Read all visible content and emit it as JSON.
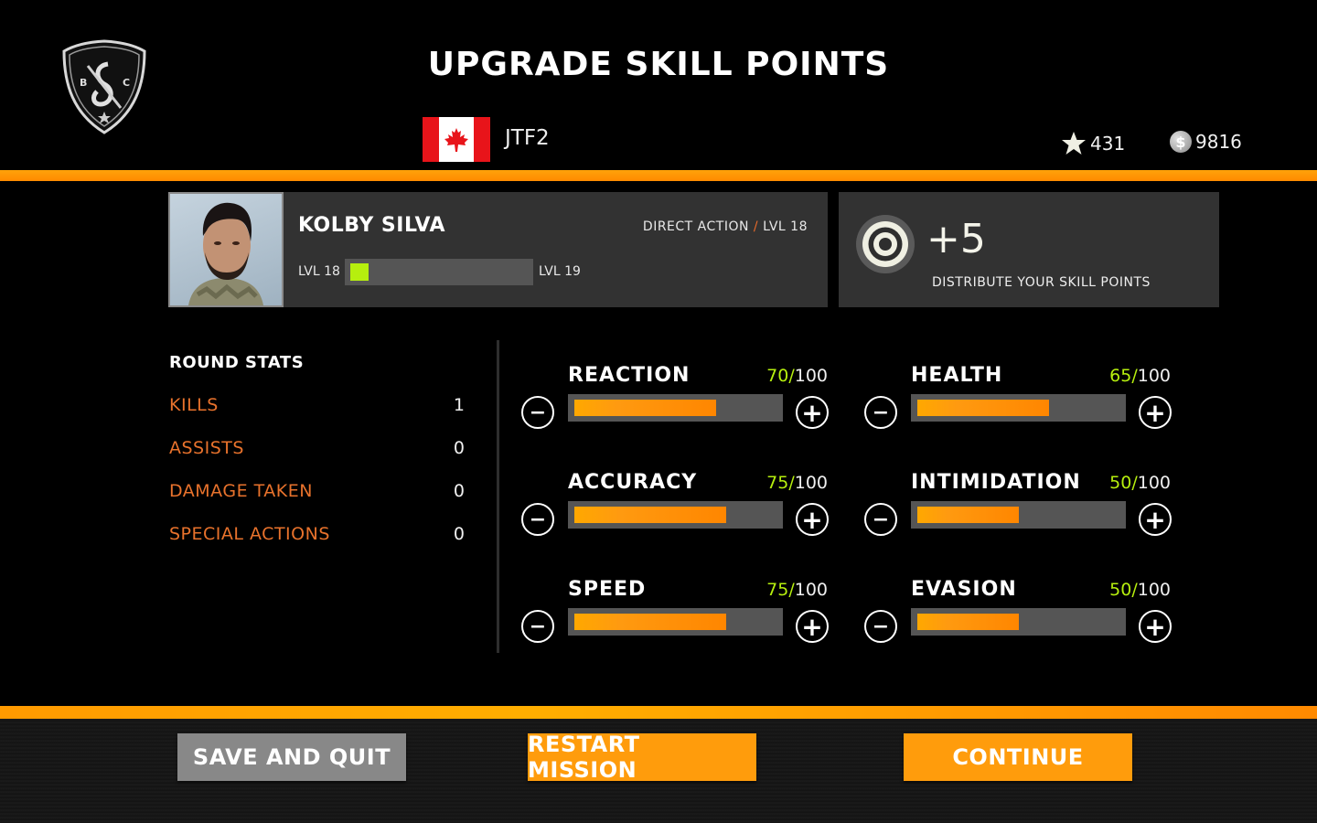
{
  "header": {
    "title": "UPGRADE SKILL POINTS",
    "logo_letters": [
      "B",
      "C"
    ],
    "unit": {
      "flag": "canada-flag",
      "name": "JTF2"
    },
    "currencies": [
      {
        "icon": "star-icon",
        "value": "431"
      },
      {
        "icon": "coin-icon",
        "symbol": "$",
        "value": "9816"
      }
    ]
  },
  "character": {
    "name": "KOLBY SILVA",
    "class": "DIRECT ACTION",
    "class_separator": "/",
    "level_label": "LVL 18",
    "xp": {
      "from": "LVL 18",
      "to": "LVL 19",
      "progress_percent": 5
    }
  },
  "skill_points": {
    "icon": "target-icon",
    "available": "+5",
    "hint": "DISTRIBUTE YOUR SKILL POINTS"
  },
  "round_stats": {
    "title": "ROUND STATS",
    "rows": [
      {
        "label": "KILLS",
        "value": "1"
      },
      {
        "label": "ASSISTS",
        "value": "0"
      },
      {
        "label": "DAMAGE TAKEN",
        "value": "0"
      },
      {
        "label": "SPECIAL ACTIONS",
        "value": "0"
      }
    ]
  },
  "skills": [
    {
      "name": "REACTION",
      "value": 70,
      "max": "100",
      "separator": "/"
    },
    {
      "name": "HEALTH",
      "value": 65,
      "max": "100",
      "separator": "/"
    },
    {
      "name": "ACCURACY",
      "value": 75,
      "max": "100",
      "separator": "/"
    },
    {
      "name": "INTIMIDATION",
      "value": 50,
      "max": "100",
      "separator": "/"
    },
    {
      "name": "SPEED",
      "value": 75,
      "max": "100",
      "separator": "/"
    },
    {
      "name": "EVASION",
      "value": 50,
      "max": "100",
      "separator": "/"
    }
  ],
  "skill_buttons": {
    "minus": "−",
    "plus": "+"
  },
  "footer": {
    "save_quit": "SAVE AND QUIT",
    "restart": "RESTART MISSION",
    "continue": "CONTINUE"
  },
  "colors": {
    "accent_orange": "#ff9c0c",
    "stat_label": "#e8722c",
    "xp_green": "#b6ef0e",
    "panel_bg": "#323232"
  }
}
